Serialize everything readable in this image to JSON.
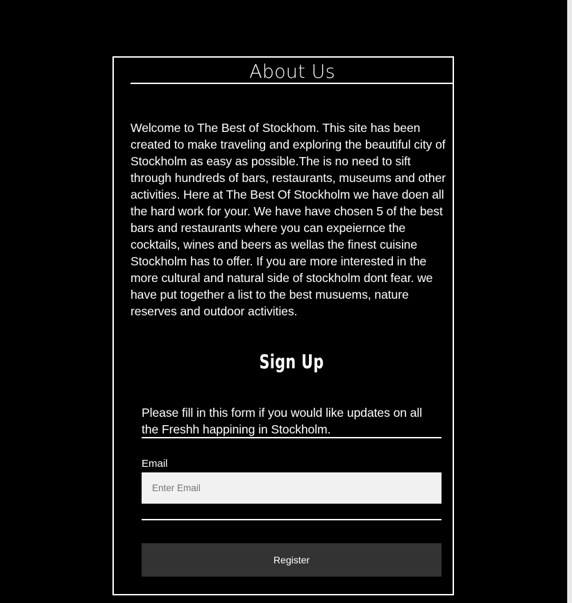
{
  "about": {
    "title": "About Us",
    "body": "Welcome to The Best of Stockhom. This site has been created to make traveling and exploring the beautiful city of Stockholm as easy as possible.The is no need to sift through hundreds of bars, restaurants, museums and other activities. Here at The Best Of Stockholm we have doen all the hard work for your. We have have chosen 5 of the best bars and restaurants where you can expeiernce the cocktails, wines and beers as wellas the finest cuisine Stockholm has to offer. If you are more interested in the more cultural and natural side of stockholm dont fear. we have put together a list to the best musuems, nature reserves and outdoor activities."
  },
  "signup": {
    "title": "Sign Up",
    "intro": "Please fill in this form if you would like updates on all the Freshh happining in Stockholm.",
    "email_label": "Email",
    "email_placeholder": "Enter Email",
    "email_value": "",
    "register_label": "Register"
  },
  "colors": {
    "background": "#000000",
    "text": "#ffffff",
    "input_background": "#f1f1f1",
    "button_background": "#333333"
  }
}
